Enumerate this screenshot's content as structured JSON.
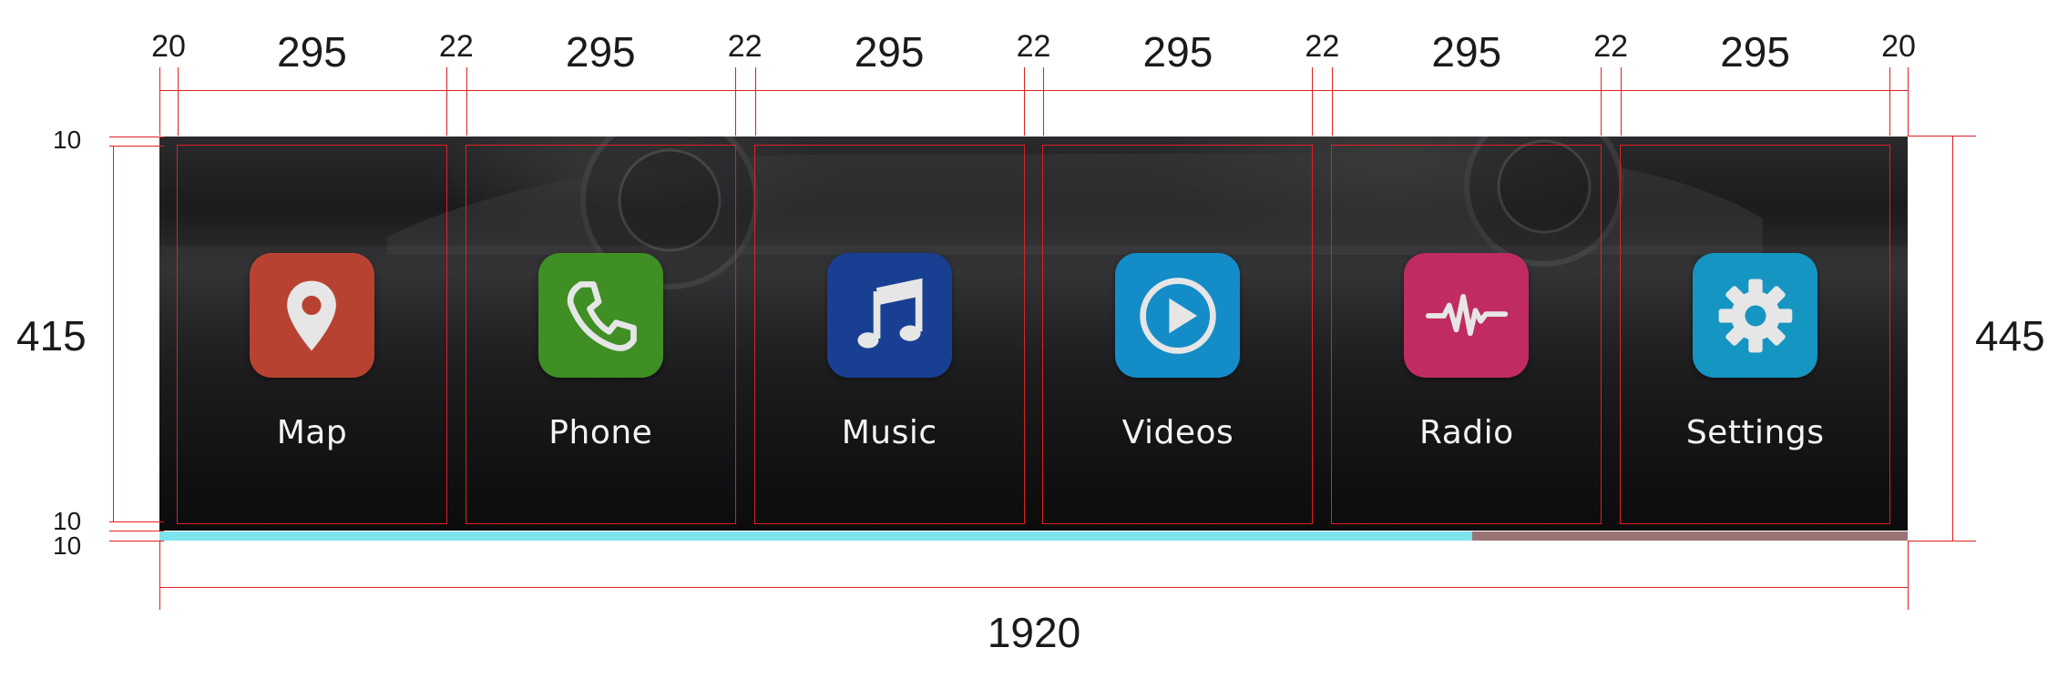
{
  "apps": [
    {
      "label": "Map",
      "icon": "map-pin-icon",
      "color": "#b84232"
    },
    {
      "label": "Phone",
      "icon": "phone-icon",
      "color": "#3f8f25"
    },
    {
      "label": "Music",
      "icon": "music-note-icon",
      "color": "#183f92"
    },
    {
      "label": "Videos",
      "icon": "play-circle-icon",
      "color": "#148cc8"
    },
    {
      "label": "Radio",
      "icon": "waveform-icon",
      "color": "#c02c62"
    },
    {
      "label": "Settings",
      "icon": "gear-icon",
      "color": "#1595c2"
    }
  ],
  "progress": {
    "fraction": 0.751,
    "fill_color": "#7fe3ee",
    "rest_color": "#9a7474"
  },
  "dimensions": {
    "margin_left": "20",
    "tile_width": "295",
    "gap": "22",
    "margin_right": "20",
    "inner_height": "415",
    "outer_height": "445",
    "top_pad": "10",
    "bottom_pad": "10",
    "bar_height": "10",
    "total_width": "1920"
  }
}
